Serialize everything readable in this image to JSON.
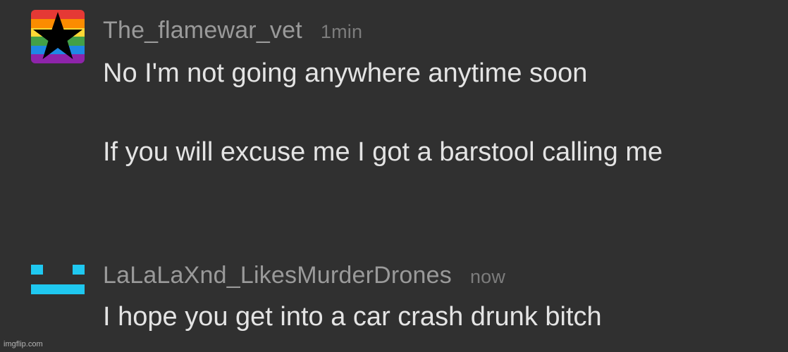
{
  "comments": [
    {
      "username": "The_flamewar_vet",
      "time": "1min",
      "avatar_icon": "rainbow-star-icon",
      "text": "No I'm not going anywhere anytime soon\n\nIf you will excuse me I got a barstool calling me"
    },
    {
      "username": "LaLaLaXnd_LikesMurderDrones",
      "time": "now",
      "avatar_icon": "cyan-face-icon",
      "text": "I hope you get into a car crash drunk bitch"
    }
  ],
  "watermark": "imgflip.com",
  "colors": {
    "background": "#303030",
    "username": "#9a9a9a",
    "timestamp": "#7c7c7c",
    "body_text": "#e4e4e4",
    "avatar2_accent": "#1fc8f0"
  }
}
